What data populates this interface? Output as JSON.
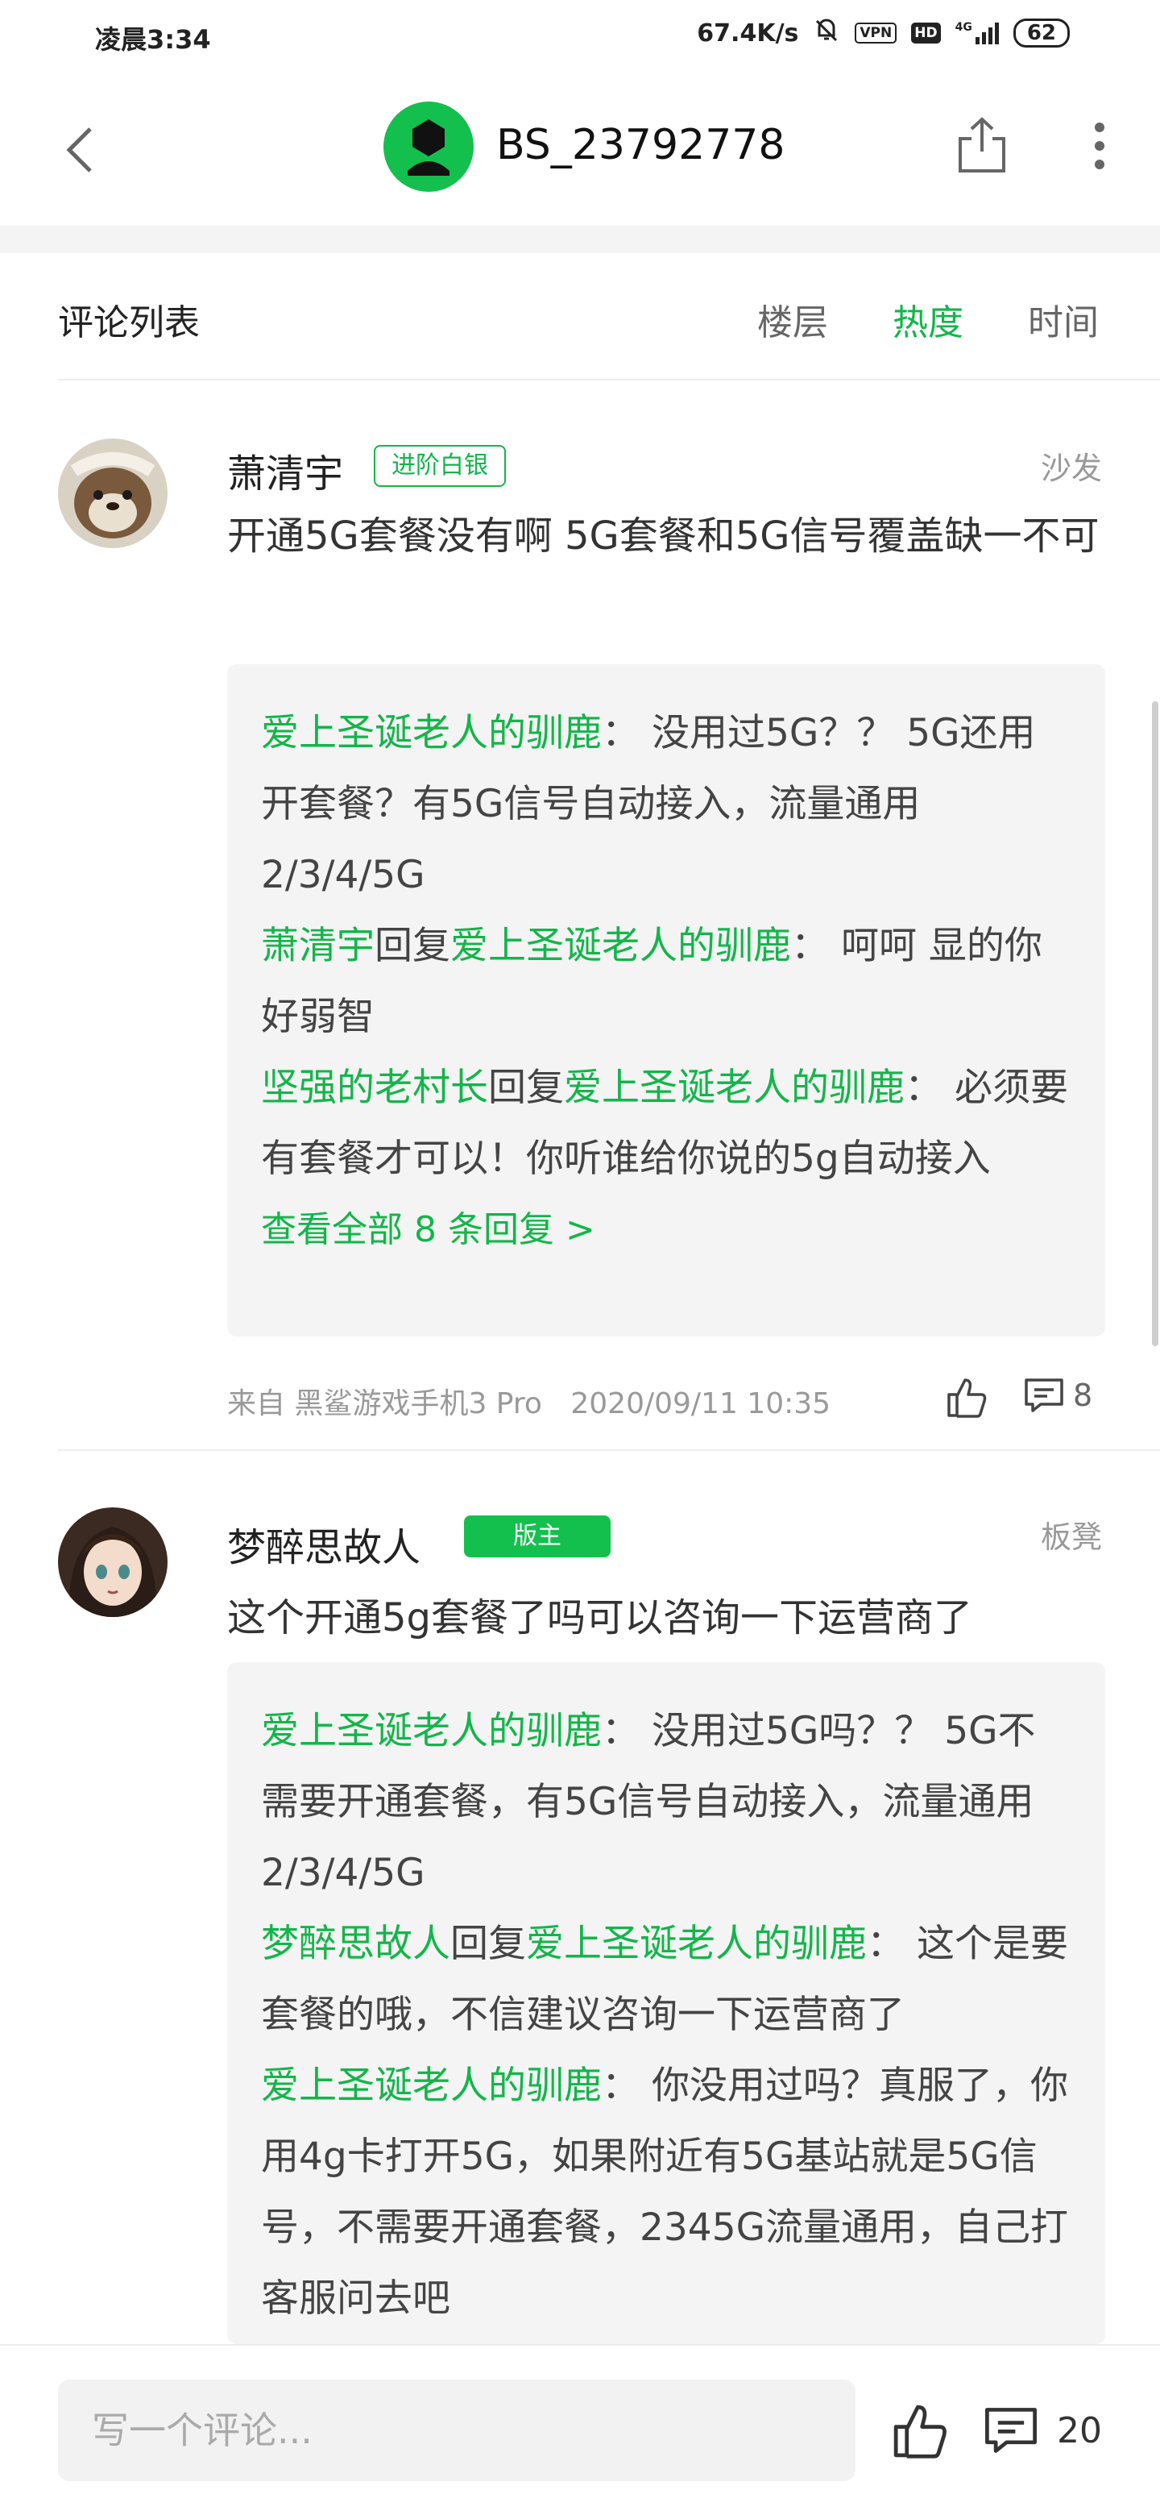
{
  "status_bar": {
    "time": "凌晨3:34",
    "speed": "67.4K/s",
    "vpn": "VPN",
    "hd": "HD",
    "network": "4G",
    "battery": "62"
  },
  "header": {
    "title": "BS_23792778"
  },
  "list_header": {
    "title": "评论列表",
    "tabs": [
      {
        "label": "楼层",
        "active": false
      },
      {
        "label": "热度",
        "active": true
      },
      {
        "label": "时间",
        "active": false
      }
    ]
  },
  "comments": [
    {
      "username": "萧清宇",
      "badge": "进阶白银",
      "floor": "沙发",
      "content": "开通5G套餐没有啊 5G套餐和5G信号覆盖缺一不可",
      "replies": [
        {
          "from": "爱上圣诞老人的驯鹿",
          "reply_word": "",
          "to": "",
          "sep": "：",
          "text": "没用过5G？？ 5G还用开套餐？有5G信号自动接入，流量通用2/3/4/5G"
        },
        {
          "from": "萧清宇",
          "reply_word": "回复",
          "to": "爱上圣诞老人的驯鹿",
          "sep": "：",
          "text": "呵呵 显的你好弱智"
        },
        {
          "from": "坚强的老村长",
          "reply_word": "回复",
          "to": "爱上圣诞老人的驯鹿",
          "sep": "：",
          "text": "必须要有套餐才可以！你听谁给你说的5g自动接入"
        }
      ],
      "view_all": "查看全部 8 条回复 >",
      "source": "来自 黑鲨游戏手机3 Pro",
      "time": "2020/09/11 10:35",
      "comment_count": "8"
    },
    {
      "username": "梦醉思故人",
      "badge": "版主",
      "floor": "板凳",
      "content": "这个开通5g套餐了吗可以咨询一下运营商了",
      "replies": [
        {
          "from": "爱上圣诞老人的驯鹿",
          "reply_word": "",
          "to": "",
          "sep": "：",
          "text": "没用过5G吗？？ 5G不需要开通套餐，有5G信号自动接入，流量通用2/3/4/5G"
        },
        {
          "from": "梦醉思故人",
          "reply_word": "回复",
          "to": "爱上圣诞老人的驯鹿",
          "sep": "：",
          "text": "这个是要套餐的哦，不信建议咨询一下运营商了"
        },
        {
          "from": "爱上圣诞老人的驯鹿",
          "reply_word": "",
          "to": "",
          "sep": "：",
          "text": "你没用过吗？真服了，你用4g卡打开5G，如果附近有5G基站就是5G信号，不需要开通套餐，2345G流量通用，自己打客服问去吧"
        }
      ]
    }
  ],
  "bottom_bar": {
    "input_placeholder": "写一个评论...",
    "comment_count": "20"
  },
  "colors": {
    "accent": "#13b54a",
    "badge_green": "#13c04e",
    "reply_bg": "#f4f4f4"
  }
}
